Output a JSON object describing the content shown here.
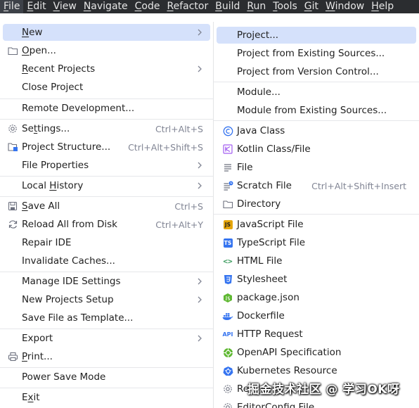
{
  "menubar": {
    "items": [
      {
        "mnemonic": "F",
        "rest": "ile"
      },
      {
        "mnemonic": "E",
        "rest": "dit"
      },
      {
        "mnemonic": "V",
        "rest": "iew"
      },
      {
        "mnemonic": "N",
        "rest": "avigate"
      },
      {
        "mnemonic": "C",
        "rest": "ode"
      },
      {
        "mnemonic": "R",
        "rest": "efactor"
      },
      {
        "mnemonic": "B",
        "rest": "uild"
      },
      {
        "mnemonic": "R",
        "rest": "un"
      },
      {
        "mnemonic": "T",
        "rest": "ools"
      },
      {
        "mnemonic": "G",
        "rest": "it"
      },
      {
        "mnemonic": "W",
        "rest": "indow"
      },
      {
        "mnemonic": "H",
        "rest": "elp"
      }
    ]
  },
  "file_menu": {
    "new": {
      "mnemonic": "N",
      "rest": "ew"
    },
    "open": {
      "mnemonic": "O",
      "rest": "pen..."
    },
    "recent_projects": {
      "mnemonic": "R",
      "rest": "ecent Projects"
    },
    "close_project": "Close Project",
    "remote_development": "Remote Development...",
    "settings": {
      "pre": "Se",
      "mnemonic": "t",
      "rest": "tings..."
    },
    "settings_shortcut": "Ctrl+Alt+S",
    "project_structure": "Project Structure...",
    "project_structure_shortcut": "Ctrl+Alt+Shift+S",
    "file_properties": "File Properties",
    "local_history": {
      "pre": "Local ",
      "mnemonic": "H",
      "rest": "istory"
    },
    "save_all": {
      "mnemonic": "S",
      "rest": "ave All"
    },
    "save_all_shortcut": "Ctrl+S",
    "reload_all": "Reload All from Disk",
    "reload_all_shortcut": "Ctrl+Alt+Y",
    "repair_ide": "Repair IDE",
    "invalidate_caches": "Invalidate Caches...",
    "manage_ide_settings": "Manage IDE Settings",
    "new_projects_setup": "New Projects Setup",
    "save_file_as_template": "Save File as Template...",
    "export": "Export",
    "print": {
      "mnemonic": "P",
      "rest": "rint..."
    },
    "power_save_mode": "Power Save Mode",
    "exit": {
      "pre": "E",
      "mnemonic": "x",
      "rest": "it"
    }
  },
  "new_submenu": {
    "project": "Project...",
    "project_from_existing_sources": "Project from Existing Sources...",
    "project_from_vcs": "Project from Version Control...",
    "module": "Module...",
    "module_from_existing_sources": "Module from Existing Sources...",
    "java_class": "Java Class",
    "kotlin_class_file": "Kotlin Class/File",
    "file": "File",
    "scratch_file": "Scratch File",
    "scratch_file_shortcut": "Ctrl+Alt+Shift+Insert",
    "directory": "Directory",
    "javascript_file": "JavaScript File",
    "typescript_file": "TypeScript File",
    "html_file": "HTML File",
    "stylesheet": "Stylesheet",
    "package_json": "package.json",
    "dockerfile": "Dockerfile",
    "http_request": "HTTP Request",
    "openapi_specification": "OpenAPI Specification",
    "kubernetes_resource": "Kubernetes Resource",
    "resource_bundle_partial": "Re",
    "editorconfig_file": "EditorConfig File"
  },
  "icons": {
    "js_badge": "JS",
    "ts_badge": "TS",
    "html_glyph": "<>",
    "api_badge": "API"
  },
  "watermark": "掘金技术社区 @ 学习OK呀",
  "colors": {
    "menubar_bg": "#2b2d30",
    "selection": "#d5e1fb",
    "shortcut": "#818594",
    "java_icon": "#3574f0",
    "kotlin_icon": "#a25cf0",
    "js_icon": "#e5a50a",
    "ts_icon": "#3574f0",
    "html_icon": "#3b9b5e",
    "css_icon": "#3574f0",
    "node_icon": "#5fb832",
    "docker_icon": "#3574f0",
    "openapi_icon": "#5fb832",
    "k8s_icon": "#3574f0"
  }
}
